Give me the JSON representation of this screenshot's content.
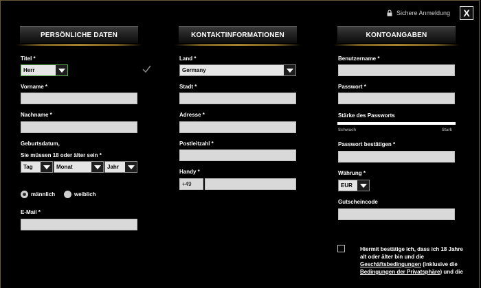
{
  "top": {
    "secure_login": "Sichere Anmeldung",
    "close": "X"
  },
  "personal": {
    "header": "PERSÖNLICHE DATEN",
    "title_label": "Titel *",
    "title_value": "Herr",
    "firstname_label": "Vorname *",
    "lastname_label": "Nachname *",
    "birth_label_1": "Geburtsdatum,",
    "birth_label_2": "Sie müssen 18 oder älter sein *",
    "day": "Tag",
    "month": "Monat",
    "year": "Jahr",
    "male": "männlich",
    "female": "weiblich",
    "email_label": "E-Mail *"
  },
  "contact": {
    "header": "KONTAKTINFORMATIONEN",
    "country_label": "Land *",
    "country_value": "Germany",
    "city_label": "Stadt *",
    "address_label": "Adresse *",
    "zip_label": "Postleitzahl *",
    "mobile_label": "Handy *",
    "mobile_prefix": "+49"
  },
  "account": {
    "header": "KONTOANGABEN",
    "username_label": "Benutzername *",
    "password_label": "Passwort *",
    "strength_label": "Stärke des Passworts",
    "weak": "Schwach",
    "strong": "Stark",
    "confirm_label": "Passwort bestätigen *",
    "currency_label": "Währung *",
    "currency_value": "EUR",
    "voucher_label": "Gutscheincode"
  },
  "terms": {
    "text_1": "Hiermit bestätige ich, dass ich 18 Jahre alt oder älter bin und die",
    "link_1": "Geschäftsbedingungen",
    "text_2": " (inklusive die ",
    "link_2": "Bedingungen der Privatsphäre",
    "text_3": ") und die"
  },
  "colors": {
    "accent_gold": "#a8822e",
    "field_bg": "#d9d9d9",
    "valid_green": "#58b14a"
  }
}
